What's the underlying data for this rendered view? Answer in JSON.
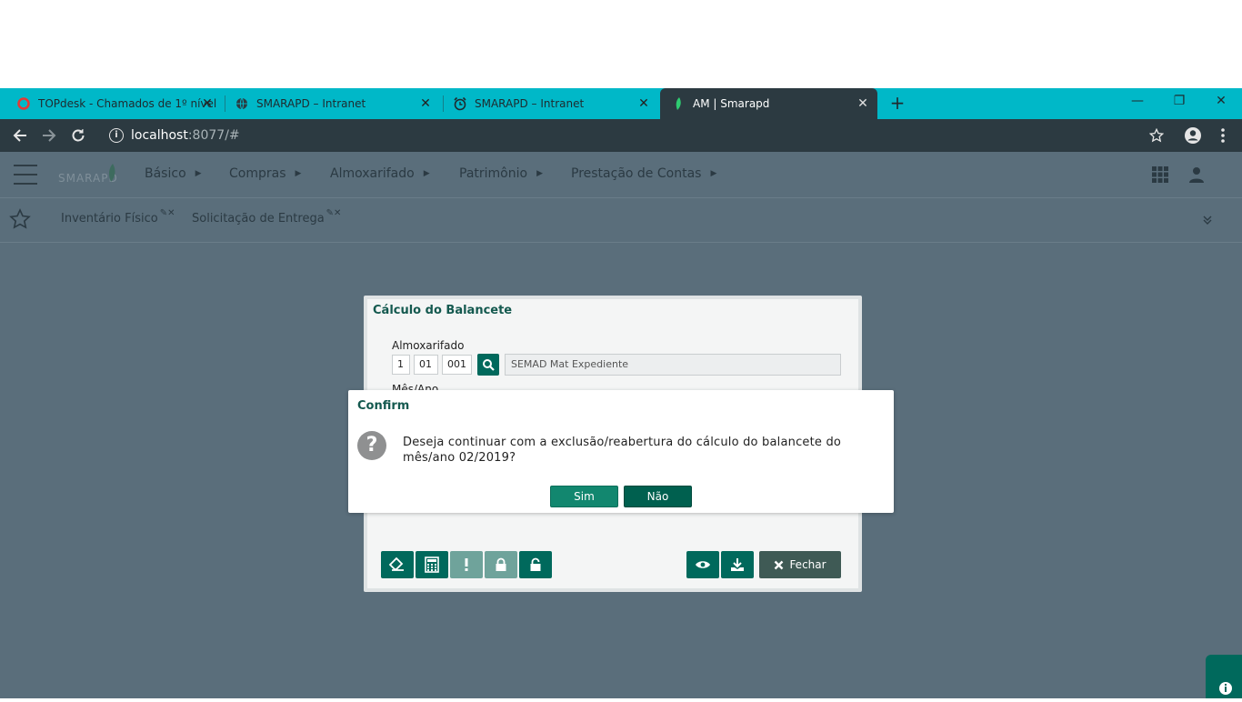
{
  "browser": {
    "tabs": [
      {
        "label": "TOPdesk - Chamados de 1º nível",
        "icon": "topdesk-icon",
        "active": false
      },
      {
        "label": "SMARAPD – Intranet",
        "icon": "globe-icon",
        "active": false
      },
      {
        "label": "SMARAPD – Intranet",
        "icon": "alarm-clock-icon",
        "active": false
      },
      {
        "label": "AM | Smarapd",
        "icon": "smarapd-leaf-icon",
        "active": true
      }
    ],
    "address": {
      "host": "localhost",
      "path": ":8077/#"
    },
    "colors": {
      "tabstrip": "#00b8c8",
      "toolbar": "#2c3a41"
    }
  },
  "app": {
    "logo_text": "SMARAPD",
    "menu": [
      "Básico",
      "Compras",
      "Almoxarifado",
      "Patrimônio",
      "Prestação de Contas"
    ],
    "favorites": [
      "Inventário Físico",
      "Solicitação de Entrega"
    ],
    "colors": {
      "overlay": "#5a6e7b",
      "primary": "#00695c"
    }
  },
  "balancete": {
    "title": "Cálculo do Balancete",
    "almox_label": "Almoxarifado",
    "almox_code": [
      "1",
      "01",
      "001"
    ],
    "almox_desc": "SEMAD Mat Expediente",
    "mes_ano_label": "Mês/Ano",
    "fechar_label": "Fechar"
  },
  "confirm": {
    "title": "Confirm",
    "message": "Deseja continuar com a exclusão/reabertura do cálculo do balancete do mês/ano 02/2019?",
    "yes_label": "Sim",
    "no_label": "Não"
  }
}
